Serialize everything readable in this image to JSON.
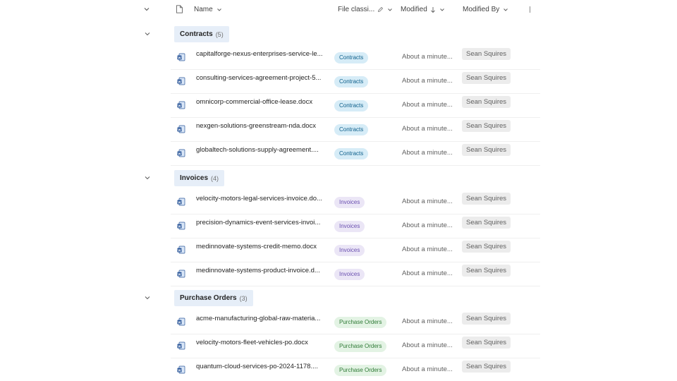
{
  "header": {
    "name_label": "Name",
    "classification_label": "File classi...",
    "modified_label": "Modified",
    "modified_by_label": "Modified By"
  },
  "groups": [
    {
      "label": "Contracts",
      "count": "(5)",
      "rows": [
        {
          "name": "capitalforge-nexus-enterprises-service-le...",
          "tag": "Contracts",
          "modified": "About a minute...",
          "by": "Sean Squires"
        },
        {
          "name": "consulting-services-agreement-project-5...",
          "tag": "Contracts",
          "modified": "About a minute...",
          "by": "Sean Squires"
        },
        {
          "name": "omnicorp-commercial-office-lease.docx",
          "tag": "Contracts",
          "modified": "About a minute...",
          "by": "Sean Squires"
        },
        {
          "name": "nexgen-solutions-greenstream-nda.docx",
          "tag": "Contracts",
          "modified": "About a minute...",
          "by": "Sean Squires"
        },
        {
          "name": "globaltech-solutions-supply-agreement....",
          "tag": "Contracts",
          "modified": "About a minute...",
          "by": "Sean Squires"
        }
      ]
    },
    {
      "label": "Invoices",
      "count": "(4)",
      "rows": [
        {
          "name": "velocity-motors-legal-services-invoice.do...",
          "tag": "Invoices",
          "modified": "About a minute...",
          "by": "Sean Squires"
        },
        {
          "name": "precision-dynamics-event-services-invoi...",
          "tag": "Invoices",
          "modified": "About a minute...",
          "by": "Sean Squires"
        },
        {
          "name": "medinnovate-systems-credit-memo.docx",
          "tag": "Invoices",
          "modified": "About a minute...",
          "by": "Sean Squires"
        },
        {
          "name": "medinnovate-systems-product-invoice.d...",
          "tag": "Invoices",
          "modified": "About a minute...",
          "by": "Sean Squires"
        }
      ]
    },
    {
      "label": "Purchase Orders",
      "count": "(3)",
      "rows": [
        {
          "name": "acme-manufacturing-global-raw-materia...",
          "tag": "Purchase Orders",
          "modified": "About a minute...",
          "by": "Sean Squires"
        },
        {
          "name": "velocity-motors-fleet-vehicles-po.docx",
          "tag": "Purchase Orders",
          "modified": "About a minute...",
          "by": "Sean Squires"
        },
        {
          "name": "quantum-cloud-services-po-2024-1178....",
          "tag": "Purchase Orders",
          "modified": "About a minute...",
          "by": "Sean Squires"
        }
      ]
    }
  ],
  "colors": {
    "contracts_tag": "#d6ecf7",
    "invoices_tag": "#ebe6f6",
    "po_tag": "#e3f3e4",
    "group_chip": "#e6eef8"
  },
  "icons": {
    "collapse": "chevron-down-icon",
    "file_type": "file-icon",
    "word_doc": "word-doc-icon",
    "sort_desc": "arrow-down-icon",
    "edit": "edit-pencil-icon"
  }
}
